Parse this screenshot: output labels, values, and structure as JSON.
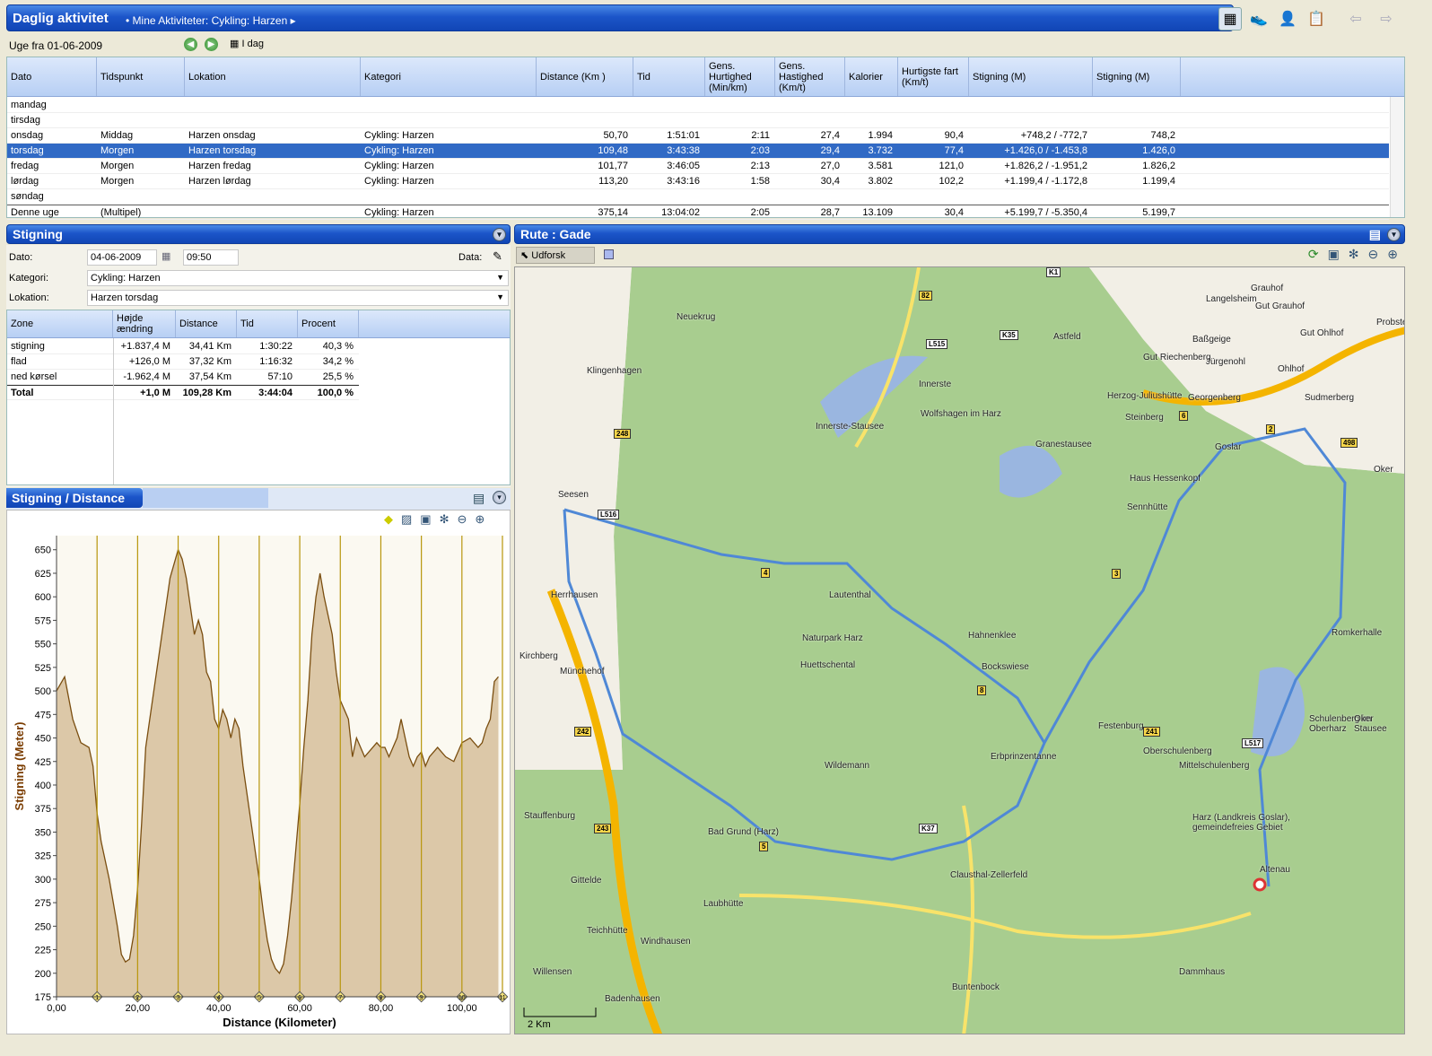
{
  "header": {
    "title": "Daglig aktivitet",
    "crumb": "Mine Aktiviteter: Cykling: Harzen"
  },
  "toolbar_icons": [
    "calendar-icon",
    "shoe-icon",
    "athlete-icon",
    "report-icon",
    "back-arrow-icon",
    "forward-arrow-icon"
  ],
  "week": {
    "label": "Uge fra 01-06-2009",
    "today": "I dag"
  },
  "table": {
    "columns": [
      "Dato",
      "Tidspunkt",
      "Lokation",
      "Kategori",
      "Distance (Km )",
      "Tid",
      "Gens. Hurtighed (Min/km)",
      "Gens. Hastighed (Km/t)",
      "Kalorier",
      "Hurtigste fart (Km/t)",
      "Stigning (M)",
      "Stigning (M)"
    ],
    "rows": [
      {
        "d": "mandag",
        "t": "",
        "l": "",
        "k": "",
        "dist": "",
        "tid": "",
        "gh": "",
        "gs": "",
        "kal": "",
        "hf": "",
        "st": "",
        "st2": ""
      },
      {
        "d": "tirsdag",
        "t": "",
        "l": "",
        "k": "",
        "dist": "",
        "tid": "",
        "gh": "",
        "gs": "",
        "kal": "",
        "hf": "",
        "st": "",
        "st2": ""
      },
      {
        "d": "onsdag",
        "t": "Middag",
        "l": "Harzen onsdag",
        "k": "Cykling: Harzen",
        "dist": "50,70",
        "tid": "1:51:01",
        "gh": "2:11",
        "gs": "27,4",
        "kal": "1.994",
        "hf": "90,4",
        "st": "+748,2 / -772,7",
        "st2": "748,2"
      },
      {
        "d": "torsdag",
        "t": "Morgen",
        "l": "Harzen torsdag",
        "k": "Cykling: Harzen",
        "dist": "109,48",
        "tid": "3:43:38",
        "gh": "2:03",
        "gs": "29,4",
        "kal": "3.732",
        "hf": "77,4",
        "st": "+1.426,0 / -1.453,8",
        "st2": "1.426,0"
      },
      {
        "d": "fredag",
        "t": "Morgen",
        "l": "Harzen fredag",
        "k": "Cykling: Harzen",
        "dist": "101,77",
        "tid": "3:46:05",
        "gh": "2:13",
        "gs": "27,0",
        "kal": "3.581",
        "hf": "121,0",
        "st": "+1.826,2 / -1.951,2",
        "st2": "1.826,2"
      },
      {
        "d": "lørdag",
        "t": "Morgen",
        "l": "Harzen lørdag",
        "k": "Cykling: Harzen",
        "dist": "113,20",
        "tid": "3:43:16",
        "gh": "1:58",
        "gs": "30,4",
        "kal": "3.802",
        "hf": "102,2",
        "st": "+1.199,4 / -1.172,8",
        "st2": "1.199,4"
      },
      {
        "d": "søndag",
        "t": "",
        "l": "",
        "k": "",
        "dist": "",
        "tid": "",
        "gh": "",
        "gs": "",
        "kal": "",
        "hf": "",
        "st": "",
        "st2": ""
      },
      {
        "d": "Denne uge",
        "t": "(Multipel)",
        "l": "",
        "k": "Cykling: Harzen",
        "dist": "375,14",
        "tid": "13:04:02",
        "gh": "2:05",
        "gs": "28,7",
        "kal": "13.109",
        "hf": "30,4",
        "st": "+5.199,7 / -5.350,4",
        "st2": "5.199,7"
      }
    ],
    "selected_index": 3
  },
  "stigning": {
    "title": "Stigning",
    "dato_label": "Dato:",
    "dato": "04-06-2009",
    "time": "09:50",
    "data_label": "Data:",
    "kategori_label": "Kategori:",
    "kategori": "Cykling: Harzen",
    "lokation_label": "Lokation:",
    "lokation": "Harzen torsdag",
    "zone_columns": [
      "Zone",
      "Højde ændring",
      "Distance",
      "Tid",
      "Procent"
    ],
    "zones": [
      {
        "z": "stigning",
        "h": "+1.837,4 M",
        "d": "34,41 Km",
        "t": "1:30:22",
        "p": "40,3 %"
      },
      {
        "z": "flad",
        "h": "+126,0 M",
        "d": "37,32 Km",
        "t": "1:16:32",
        "p": "34,2 %"
      },
      {
        "z": "ned kørsel",
        "h": "-1.962,4 M",
        "d": "37,54 Km",
        "t": "57:10",
        "p": "25,5 %"
      },
      {
        "z": "Total",
        "h": "+1,0 M",
        "d": "109,28 Km",
        "t": "3:44:04",
        "p": "100,0 %"
      }
    ]
  },
  "chart_panel_title": "Stigning / Distance",
  "chart_data": {
    "type": "area",
    "xlabel": "Distance (Kilometer)",
    "ylabel": "Stigning (Meter)",
    "xlim": [
      0,
      110
    ],
    "ylim": [
      175,
      665
    ],
    "xticks": [
      "0,00",
      "20,00",
      "40,00",
      "60,00",
      "80,00",
      "100,00"
    ],
    "yticks": [
      175,
      200,
      225,
      250,
      275,
      300,
      325,
      350,
      375,
      400,
      425,
      450,
      475,
      500,
      525,
      550,
      575,
      600,
      625,
      650
    ],
    "markers": [
      10,
      20,
      30,
      40,
      50,
      60,
      70,
      80,
      90,
      100,
      110
    ],
    "marker_labels": [
      "1",
      "2",
      "3",
      "4",
      "5",
      "6",
      "7",
      "8",
      "9",
      "10",
      "11"
    ],
    "x": [
      0,
      2,
      4,
      6,
      8,
      9,
      10,
      11,
      13,
      15,
      16,
      17,
      18,
      19,
      20,
      21,
      22,
      24,
      26,
      28,
      30,
      31,
      32,
      33,
      34,
      35,
      36,
      37,
      38,
      39,
      40,
      41,
      42,
      43,
      44,
      45,
      46,
      47,
      48,
      49,
      50,
      51,
      52,
      53,
      54,
      55,
      56,
      57,
      58,
      59,
      60,
      61,
      62,
      63,
      64,
      65,
      66,
      67,
      68,
      69,
      70,
      71,
      72,
      73,
      74,
      75,
      76,
      78,
      79,
      80,
      81,
      82,
      83,
      84,
      85,
      86,
      87,
      88,
      89,
      90,
      91,
      92,
      94,
      96,
      98,
      100,
      102,
      104,
      105,
      106,
      107,
      108,
      109
    ],
    "y": [
      500,
      515,
      470,
      445,
      440,
      420,
      370,
      340,
      300,
      250,
      220,
      212,
      215,
      240,
      290,
      360,
      440,
      500,
      560,
      620,
      650,
      640,
      620,
      590,
      560,
      575,
      560,
      520,
      510,
      470,
      460,
      480,
      470,
      450,
      470,
      460,
      420,
      390,
      360,
      330,
      300,
      265,
      235,
      215,
      205,
      200,
      210,
      240,
      280,
      330,
      380,
      440,
      490,
      560,
      600,
      625,
      600,
      580,
      560,
      520,
      490,
      480,
      470,
      430,
      450,
      440,
      430,
      440,
      445,
      440,
      440,
      430,
      440,
      450,
      470,
      450,
      430,
      420,
      430,
      435,
      420,
      430,
      440,
      430,
      425,
      445,
      450,
      440,
      445,
      460,
      470,
      510,
      515
    ]
  },
  "map": {
    "title": "Rute : Gade",
    "explore": "Udforsk",
    "scale": "2 Km",
    "places": [
      "Langelsheim",
      "Astfeld",
      "Grauhof",
      "Gut Grauhof",
      "Gut Ohlhof",
      "Baßgeige",
      "Jürgenohl",
      "Ohlhof",
      "Gut Riechenberg",
      "Georgenberg",
      "Sudmerberg",
      "Klingenhagen",
      "Herzog-Juliushütte",
      "Steinberg",
      "Goslar",
      "Oker",
      "Innerste-Stausee",
      "Wolfshagen im Harz",
      "Granestausee",
      "Haus Hessenkopf",
      "Sennhütte",
      "Seesen",
      "Herrhausen",
      "Lautenthal",
      "Kirchberg",
      "Münchehof",
      "Naturpark Harz",
      "Huettschental",
      "Hahnenklee",
      "Bockswiese",
      "Romkerhalle",
      "Festenburg",
      "Schulenberg im Oberharz",
      "Oker Stausee",
      "Oberschulenberg",
      "Mittelschulenberg",
      "Wildemann",
      "Erbprinzentanne",
      "Stauffenburg",
      "Bad Grund (Harz)",
      "Clausthal-Zellerfeld",
      "Harz (Landkreis Goslar), gemeindefreies Gebiet",
      "Altenau",
      "Gittelde",
      "Laubhütte",
      "Teichhütte",
      "Windhausen",
      "Willensen",
      "Badenhausen",
      "Dammhaus",
      "Buntenbock",
      "Probste",
      "Neuekrug",
      "Innerste"
    ],
    "roads": [
      "K1",
      "82",
      "L515",
      "K35",
      "248",
      "L516",
      "242",
      "243",
      "241",
      "498",
      "L517",
      "K37",
      "6",
      "2",
      "3",
      "8",
      "5",
      "4"
    ]
  }
}
